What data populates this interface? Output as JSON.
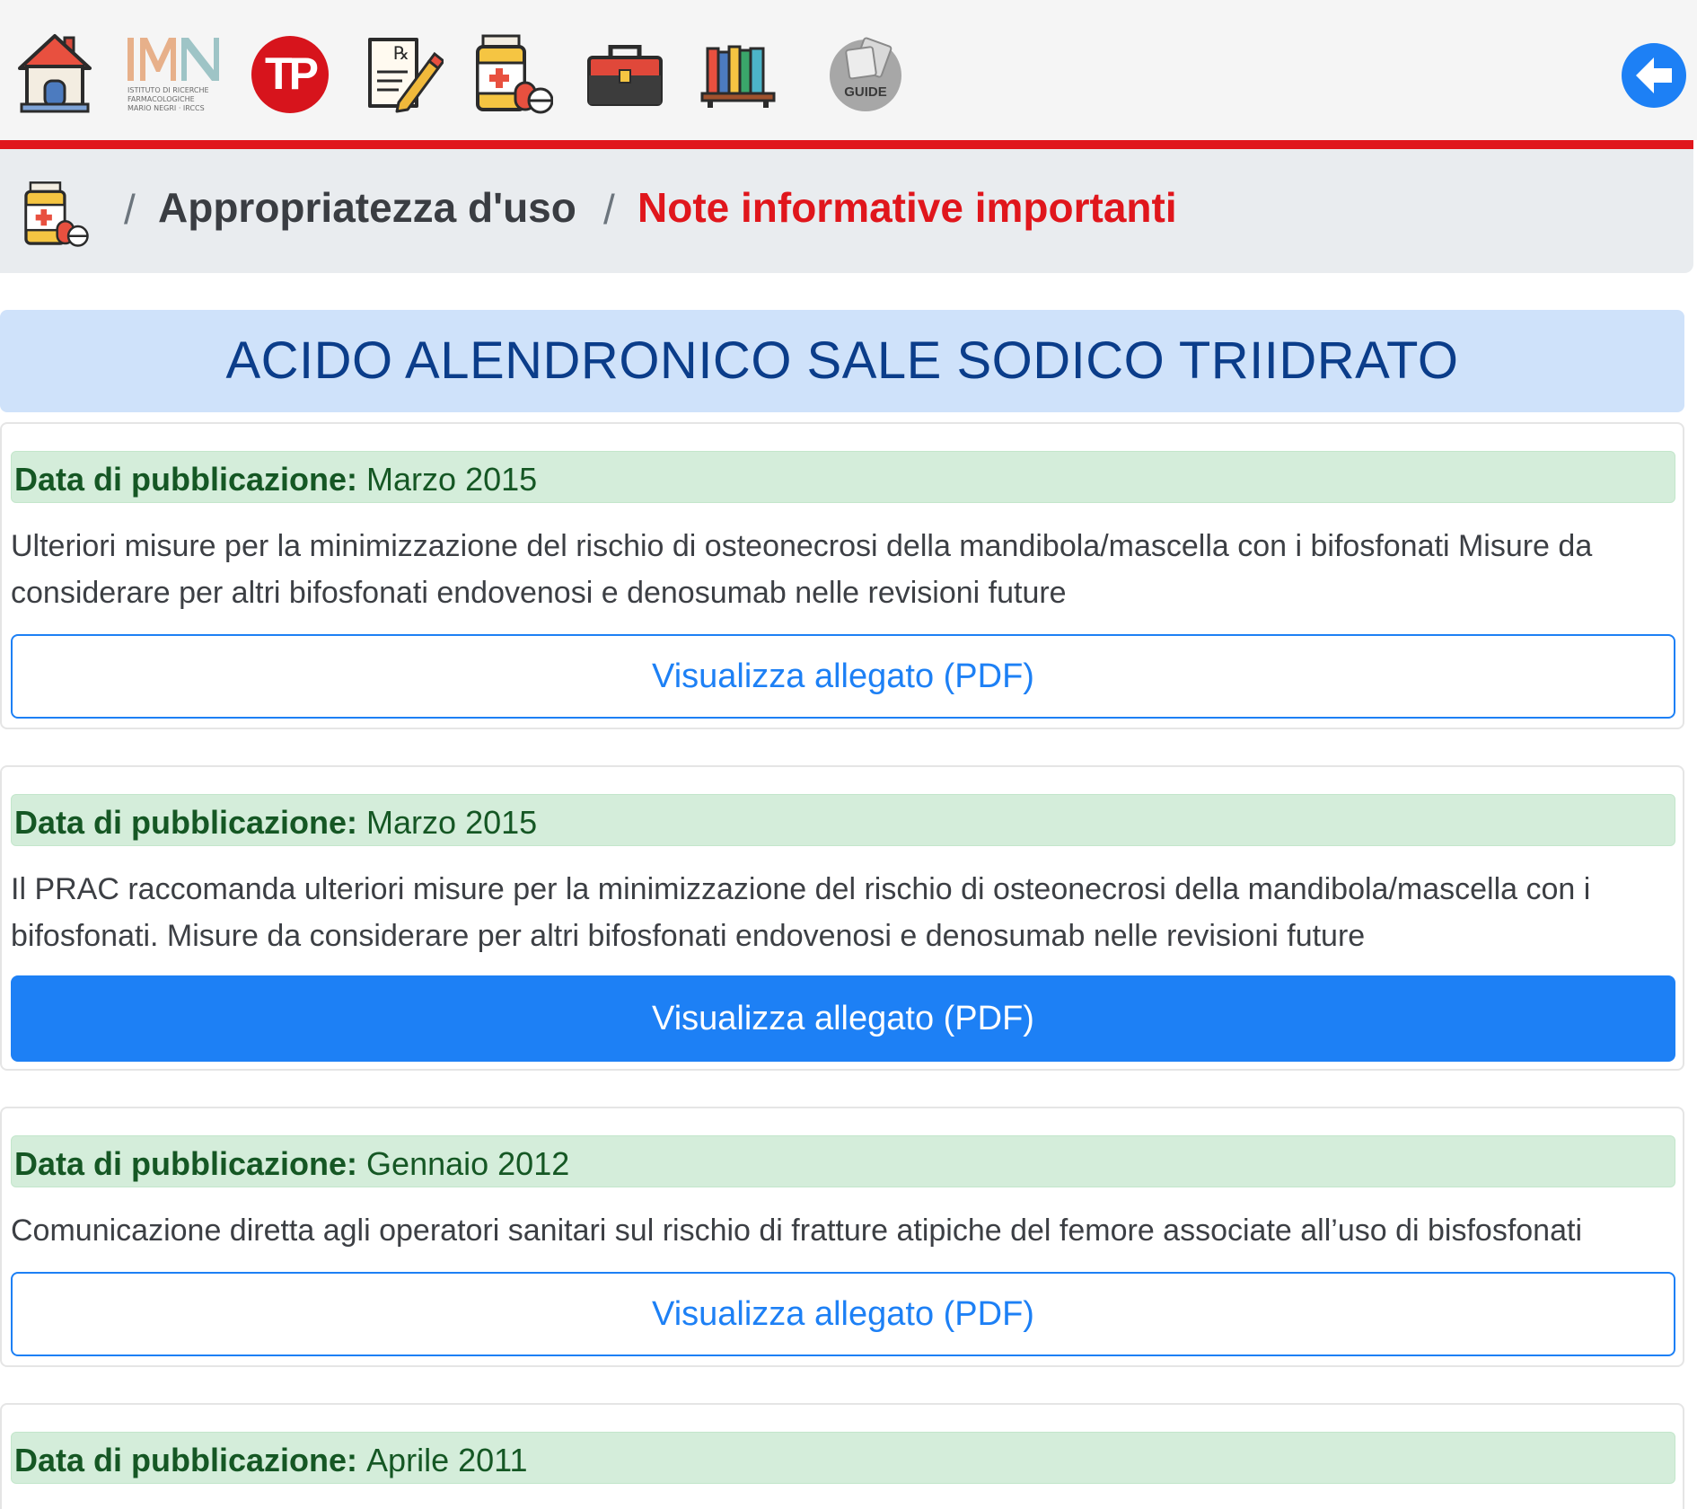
{
  "toolbar": {
    "icons": [
      "home-icon",
      "imn-logo",
      "tp-logo",
      "prescription-icon",
      "medicine-bottle-icon",
      "toolbox-icon",
      "bookshelf-icon",
      "guide-icon"
    ],
    "imn_logo": {
      "letters": "IMN",
      "lines": [
        "ISTITUTO DI RICERCHE",
        "FARMACOLOGICHE",
        "MARIO NEGRI · IRCCS"
      ]
    },
    "tp_logo_text": "TP",
    "guide_text": "GUIDE",
    "back_icon": "arrow-left-circle-icon",
    "accent_color": "#e0161c"
  },
  "breadcrumb": {
    "icon": "medicine-bottle-icon",
    "items": [
      "Appropriatezza d'uso",
      "Note informative importanti"
    ],
    "separator": "/"
  },
  "drug": {
    "title": "ACIDO ALENDRONICO SALE SODICO TRIIDRATO"
  },
  "cards": [
    {
      "date_label": "Data di pubblicazione:",
      "date_value": "Marzo 2015",
      "description": "Ulteriori misure per la minimizzazione del rischio di osteonecrosi della mandibola/mascella con i bifosfonati Misure da considerare per altri bifosfonati endovenosi e denosumab nelle revisioni future",
      "button_label": "Visualizza allegato (PDF)"
    },
    {
      "date_label": "Data di pubblicazione:",
      "date_value": "Marzo 2015",
      "description": "Il PRAC raccomanda ulteriori misure per la minimizzazione del rischio di osteonecrosi della mandibola/mascella con i bifosfonati. Misure da considerare per altri bifosfonati endovenosi e denosumab nelle revisioni future",
      "button_label": "Visualizza allegato (PDF)"
    },
    {
      "date_label": "Data di pubblicazione:",
      "date_value": "Gennaio 2012",
      "description": "Comunicazione diretta agli operatori sanitari sul rischio di fratture atipiche del femore associate all’uso di bisfosfonati",
      "button_label": "Visualizza allegato (PDF)"
    },
    {
      "date_label": "Data di pubblicazione:",
      "date_value": "Aprile 2011"
    }
  ],
  "colors": {
    "primary": "#1d80f5",
    "date_bg": "#d4edda",
    "date_text": "#155724",
    "title_bg": "#cfe2fa",
    "title_text": "#0b3d8a"
  }
}
